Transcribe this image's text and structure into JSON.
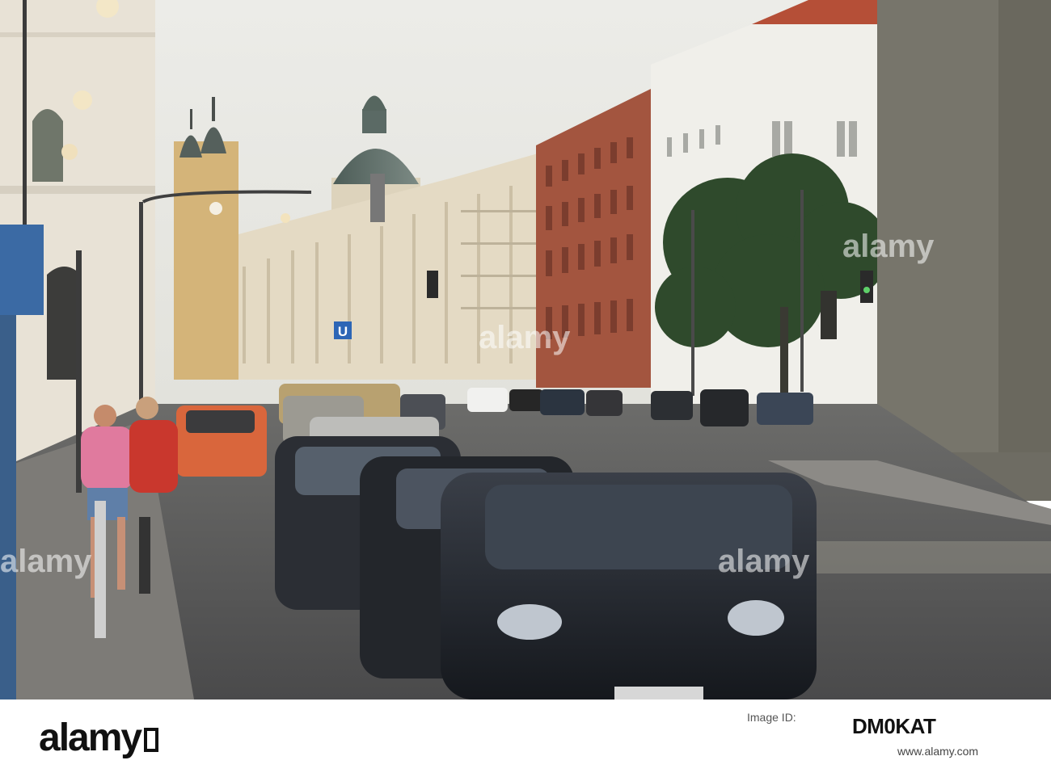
{
  "image": {
    "subject": "photo-street-scene",
    "sign_u_label": "U",
    "colors": {
      "sky": "#e9e9e4",
      "road": "#5b5b5c",
      "brick": "#a3553f",
      "dome": "#5a6b66",
      "tower": "#d6b97a"
    }
  },
  "watermark": {
    "brand": "alamy"
  },
  "footer": {
    "logo": "alamy",
    "image_id_label": "Image ID:",
    "image_id": "DM0KAT",
    "url": "www.alamy.com"
  }
}
